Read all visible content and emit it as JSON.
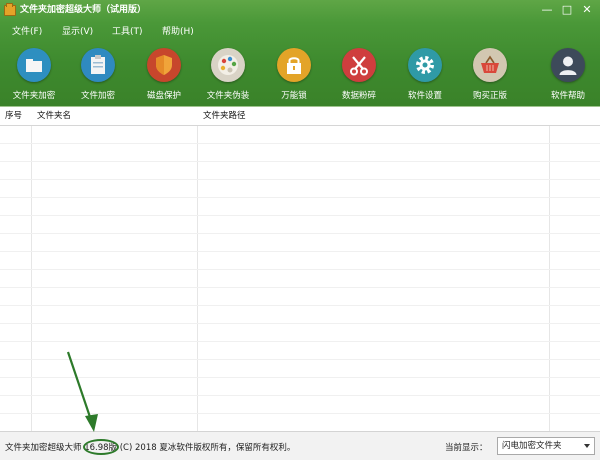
{
  "window": {
    "title": "文件夹加密超级大师（试用版）",
    "min_glyph": "—",
    "max_glyph": "□",
    "close_glyph": "✕"
  },
  "menu": [
    "文件(F)",
    "显示(V)",
    "工具(T)",
    "帮助(H)"
  ],
  "toolbar": [
    {
      "label": "文件夹加密",
      "icon": "folder-icon",
      "color": "#2e8fc0"
    },
    {
      "label": "文件加密",
      "icon": "clipboard-icon",
      "color": "#2f8ac0"
    },
    {
      "label": "磁盘保护",
      "icon": "shield-icon",
      "color": "#c7462c"
    },
    {
      "label": "文件夹伪装",
      "icon": "palette-icon",
      "color": "#d9d3c6"
    },
    {
      "label": "万能锁",
      "icon": "lock-icon",
      "color": "#e3a428"
    },
    {
      "label": "数据粉碎",
      "icon": "scissors-icon",
      "color": "#cf3e3e"
    },
    {
      "label": "软件设置",
      "icon": "gear-icon",
      "color": "#2f9aa6"
    },
    {
      "label": "购买正版",
      "icon": "basket-icon",
      "color": "#d2c7b1"
    },
    {
      "label": "软件帮助",
      "icon": "user-icon",
      "color": "#3d4a5a"
    }
  ],
  "table": {
    "columns": [
      "序号",
      "文件夹名",
      "文件夹路径"
    ]
  },
  "status": {
    "copyright": "文件夹加密超级大师 16.98版 (C) 2018  夏冰软件版权所有，保留所有权利。",
    "current_label": "当前显示：",
    "view_selected": "闪电加密文件夹"
  }
}
